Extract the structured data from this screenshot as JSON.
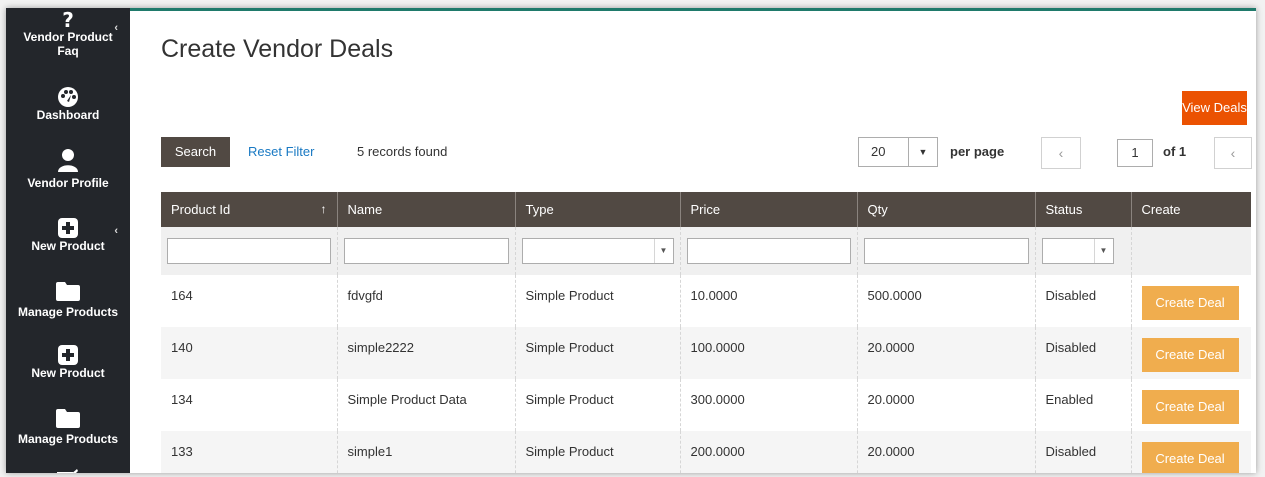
{
  "sidebar": {
    "items": [
      {
        "label": "Vendor Product Faq",
        "icon": "question-icon"
      },
      {
        "label": "Dashboard",
        "icon": "dashboard-icon"
      },
      {
        "label": "Vendor Profile",
        "icon": "user-icon"
      },
      {
        "label": "New Product",
        "icon": "plus-square-icon"
      },
      {
        "label": "Manage Products",
        "icon": "folder-icon"
      },
      {
        "label": "New Product",
        "icon": "plus-square-icon"
      },
      {
        "label": "Manage Products",
        "icon": "folder-icon"
      }
    ],
    "chevron": "‹"
  },
  "page": {
    "title": "Create Vendor Deals"
  },
  "actions": {
    "view_deals": "View Deals"
  },
  "toolbar": {
    "search": "Search",
    "reset_filter": "Reset Filter",
    "records": "5 records found",
    "per_page_value": "20",
    "per_page_label": "per page",
    "page_current": "1",
    "page_of": "of 1",
    "prev": "‹",
    "next": "‹"
  },
  "table": {
    "columns": [
      "Product Id",
      "Name",
      "Type",
      "Price",
      "Qty",
      "Status",
      "Create"
    ],
    "sort_indicator": "↑",
    "rows": [
      {
        "id": "164",
        "name": "fdvgfd",
        "type": "Simple Product",
        "price": "10.0000",
        "qty": "500.0000",
        "status": "Disabled",
        "action": "Create Deal"
      },
      {
        "id": "140",
        "name": "simple2222",
        "type": "Simple Product",
        "price": "100.0000",
        "qty": "20.0000",
        "status": "Disabled",
        "action": "Create Deal"
      },
      {
        "id": "134",
        "name": "Simple Product Data",
        "type": "Simple Product",
        "price": "300.0000",
        "qty": "20.0000",
        "status": "Enabled",
        "action": "Create Deal"
      },
      {
        "id": "133",
        "name": "simple1",
        "type": "Simple Product",
        "price": "200.0000",
        "qty": "20.0000",
        "status": "Disabled",
        "action": "Create Deal"
      }
    ]
  },
  "colors": {
    "sidebar": "#23262b",
    "header": "#514943",
    "accent": "#eb5202",
    "deal_button": "#f0ad4e",
    "link": "#1979c3"
  }
}
